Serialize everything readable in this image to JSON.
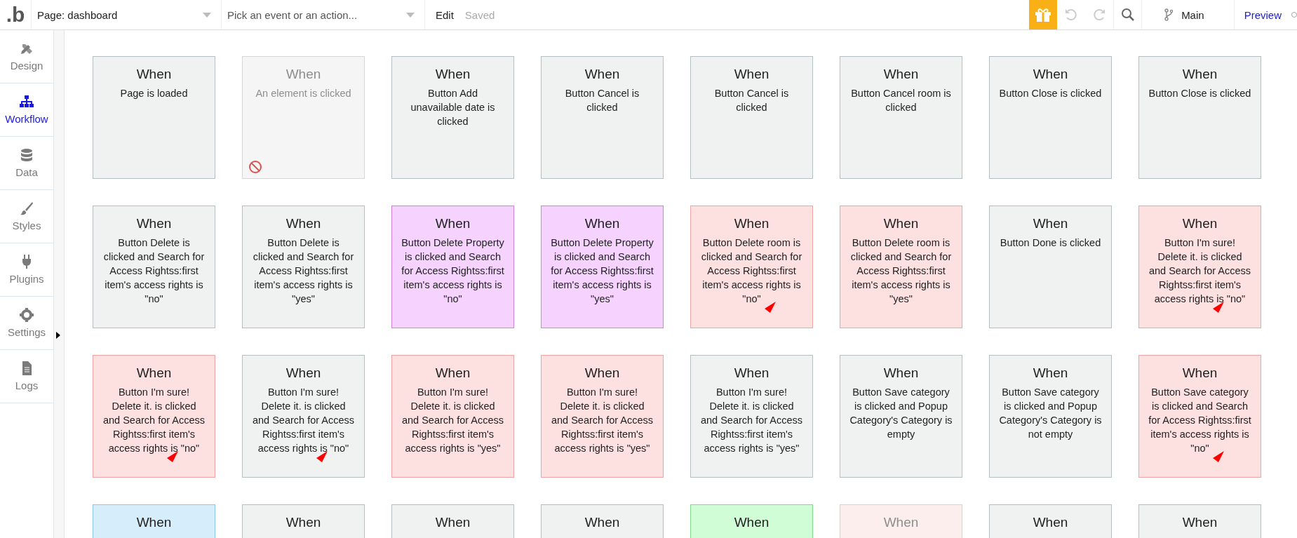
{
  "topbar": {
    "logo": ".b",
    "page_select": "Page: dashboard",
    "event_select": {
      "placeholder": "Pick an event or an action..."
    },
    "edit": "Edit",
    "saved": "Saved",
    "branch": "Main",
    "preview": "Preview"
  },
  "sidebar": {
    "items": [
      {
        "label": "Design",
        "selected": false
      },
      {
        "label": "Workflow",
        "selected": true
      },
      {
        "label": "Data",
        "selected": false
      },
      {
        "label": "Styles",
        "selected": false
      },
      {
        "label": "Plugins",
        "selected": false
      },
      {
        "label": "Settings",
        "selected": false
      },
      {
        "label": "Logs",
        "selected": false
      }
    ]
  },
  "events": [
    {
      "title": "When",
      "text": "Page is loaded",
      "color": "#f0f2f1",
      "disabled": false,
      "flagged": false
    },
    {
      "title": "When",
      "text": "An element is clicked",
      "color": "#f5f5f5",
      "disabled": true,
      "flagged": false
    },
    {
      "title": "When",
      "text": "Button Add unavailable date is clicked",
      "color": "#f0f2f1",
      "disabled": false,
      "flagged": false
    },
    {
      "title": "When",
      "text": "Button Cancel is clicked",
      "color": "#f0f2f1",
      "disabled": false,
      "flagged": false
    },
    {
      "title": "When",
      "text": "Button Cancel is clicked",
      "color": "#f0f2f1",
      "disabled": false,
      "flagged": false
    },
    {
      "title": "When",
      "text": "Button Cancel room is clicked",
      "color": "#f0f2f1",
      "disabled": false,
      "flagged": false
    },
    {
      "title": "When",
      "text": "Button Close is clicked",
      "color": "#f0f2f1",
      "disabled": false,
      "flagged": false
    },
    {
      "title": "When",
      "text": "Button Close is clicked",
      "color": "#f0f2f1",
      "disabled": false,
      "flagged": false
    },
    {
      "title": "When",
      "text": "Button Delete is clicked and Search for Access Rightss:first item's access rights is \"no\"",
      "color": "#f0f2f1",
      "disabled": false,
      "flagged": false
    },
    {
      "title": "When",
      "text": "Button Delete is clicked and Search for Access Rightss:first item's access rights is \"yes\"",
      "color": "#f0f2f1",
      "disabled": false,
      "flagged": false
    },
    {
      "title": "When",
      "text": "Button Delete Property is clicked and Search for Access Rightss:first item's access rights is \"no\"",
      "color": "#f5d3fe",
      "disabled": false,
      "flagged": false
    },
    {
      "title": "When",
      "text": "Button Delete Property is clicked and Search for Access Rightss:first item's access rights is \"yes\"",
      "color": "#f5d3fe",
      "disabled": false,
      "flagged": false
    },
    {
      "title": "When",
      "text": "Button Delete room is clicked and Search for Access Rightss:first item's access rights is \"no\"",
      "color": "#fde0e0",
      "disabled": false,
      "flagged": true
    },
    {
      "title": "When",
      "text": "Button Delete room is clicked and Search for Access Rightss:first item's access rights is \"yes\"",
      "color": "#fde0e0",
      "disabled": false,
      "flagged": false
    },
    {
      "title": "When",
      "text": "Button Done is clicked",
      "color": "#f0f2f1",
      "disabled": false,
      "flagged": false
    },
    {
      "title": "When",
      "text": "Button I'm sure! Delete it. is clicked and Search for Access Rightss:first item's access rights is \"no\"",
      "color": "#fde0e0",
      "disabled": false,
      "flagged": true
    },
    {
      "title": "When",
      "text": "Button I'm sure! Delete it. is clicked and Search for Access Rightss:first item's access rights is \"no\"",
      "color": "#fde0e0",
      "disabled": false,
      "flagged": true
    },
    {
      "title": "When",
      "text": "Button I'm sure! Delete it. is clicked and Search for Access Rightss:first item's access rights is \"no\"",
      "color": "#f0f2f1",
      "disabled": false,
      "flagged": true
    },
    {
      "title": "When",
      "text": "Button I'm sure! Delete it. is clicked and Search for Access Rightss:first item's access rights is \"yes\"",
      "color": "#fde0e0",
      "disabled": false,
      "flagged": false
    },
    {
      "title": "When",
      "text": "Button I'm sure! Delete it. is clicked and Search for Access Rightss:first item's access rights is \"yes\"",
      "color": "#fde0e0",
      "disabled": false,
      "flagged": false
    },
    {
      "title": "When",
      "text": "Button I'm sure! Delete it. is clicked and Search for Access Rightss:first item's access rights is \"yes\"",
      "color": "#f0f2f1",
      "disabled": false,
      "flagged": false
    },
    {
      "title": "When",
      "text": "Button Save category is clicked and Popup Category's Category is empty",
      "color": "#f0f2f1",
      "disabled": false,
      "flagged": false
    },
    {
      "title": "When",
      "text": "Button Save category is clicked and Popup Category's Category is not empty",
      "color": "#f0f2f1",
      "disabled": false,
      "flagged": false
    },
    {
      "title": "When",
      "text": "Button Save category is clicked and Search for Access Rightss:first item's access rights is \"no\"",
      "color": "#fde0e0",
      "disabled": false,
      "flagged": true
    },
    {
      "title": "When",
      "color": "#d6eefb",
      "disabled": false,
      "flagged": false
    },
    {
      "title": "When",
      "color": "#f0f2f1",
      "disabled": false,
      "flagged": false
    },
    {
      "title": "When",
      "color": "#f0f2f1",
      "disabled": false,
      "flagged": false
    },
    {
      "title": "When",
      "color": "#f0f2f1",
      "disabled": false,
      "flagged": false
    },
    {
      "title": "When",
      "color": "#d0fdd6",
      "disabled": false,
      "flagged": false
    },
    {
      "title": "When",
      "color": "#fdeeee",
      "disabled": true,
      "flagged": false
    },
    {
      "title": "When",
      "color": "#f0f2f1",
      "disabled": false,
      "flagged": false
    },
    {
      "title": "When",
      "color": "#f0f2f1",
      "disabled": false,
      "flagged": false
    }
  ]
}
